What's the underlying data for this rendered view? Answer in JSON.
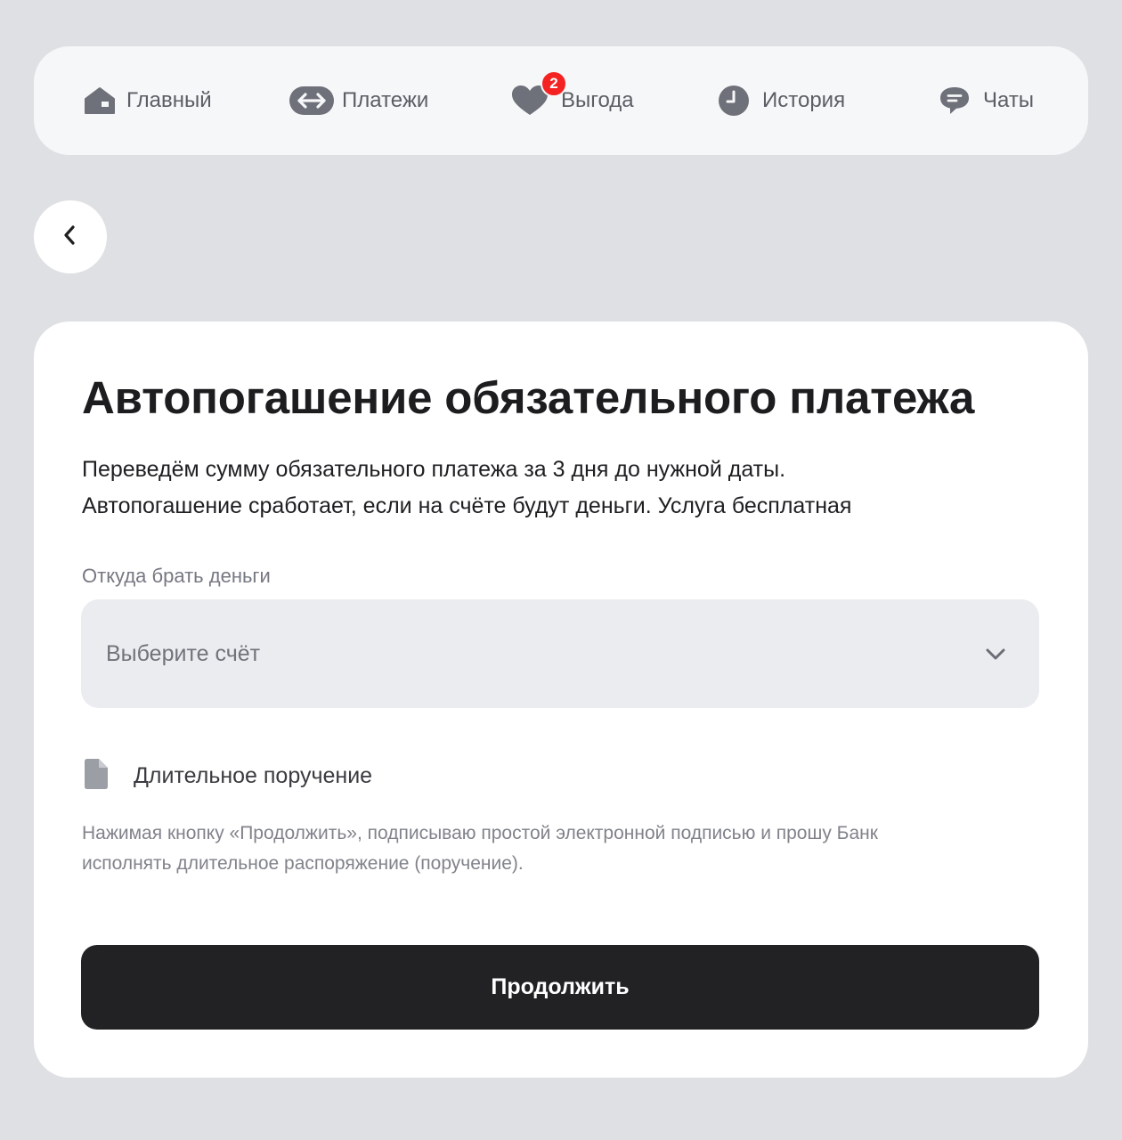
{
  "nav": {
    "items": [
      {
        "label": "Главный",
        "icon": "home-icon"
      },
      {
        "label": "Платежи",
        "icon": "transfer-arrows-icon"
      },
      {
        "label": "Выгода",
        "icon": "heart-icon",
        "badge": "2"
      },
      {
        "label": "История",
        "icon": "clock-icon"
      },
      {
        "label": "Чаты",
        "icon": "chat-bubble-icon"
      }
    ]
  },
  "back_button": {
    "icon": "chevron-left-icon"
  },
  "form": {
    "title": "Автопогашение обязательного платежа",
    "description_lines": [
      "Переведём сумму обязательного платежа за 3 дня до нужной даты.",
      "Автопогашение сработает, если на счёте будут деньги. Услуга бесплатная"
    ],
    "account_field": {
      "label": "Откуда брать деньги",
      "placeholder": "Выберите счёт",
      "icon": "chevron-down-icon"
    },
    "standing_order": {
      "label": "Длительное поручение",
      "icon": "document-icon"
    },
    "disclaimer_lines": [
      "Нажимая кнопку «Продолжить», подписываю простой электронной подписью и прошу Банк",
      "исполнять длительное распоряжение (поручение)."
    ],
    "continue_label": "Продолжить"
  },
  "colors": {
    "page_background": "#dfe0e4",
    "nav_background": "#f6f7f8",
    "card_background": "#ffffff",
    "icon_gray": "#6f717a",
    "badge_red": "#f52222",
    "select_background": "#ebecef",
    "button_dark": "#222224"
  }
}
